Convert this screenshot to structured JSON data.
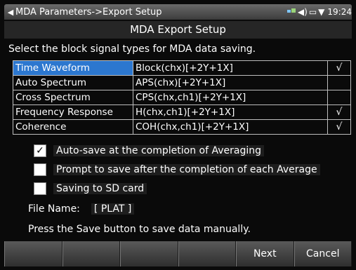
{
  "status_bar": {
    "title": "MDA Parameters->Export Setup",
    "time": "19:24"
  },
  "heading": "MDA Export Setup",
  "instruction": "Select the block signal types for MDA data saving.",
  "signal_table": [
    {
      "name": "Time Waveform",
      "formula": "Block(chx)[+2Y+1X]",
      "check": "√"
    },
    {
      "name": "Auto Spectrum",
      "formula": "APS(chx)[+2Y+1X]",
      "check": ""
    },
    {
      "name": "Cross Spectrum",
      "formula": "CPS(chx,ch1)[+2Y+1X]",
      "check": ""
    },
    {
      "name": "Frequency Response",
      "formula": "H(chx,ch1)[+2Y+1X]",
      "check": "√"
    },
    {
      "name": "Coherence",
      "formula": "COH(chx,ch1)[+2Y+1X]",
      "check": "√"
    }
  ],
  "options": {
    "autosave": {
      "label": "Auto-save at the completion of Averaging",
      "checked": true,
      "mark": "✓"
    },
    "prompt": {
      "label": "Prompt to save after the completion of each Average",
      "checked": false,
      "mark": ""
    },
    "sdcard": {
      "label": "Saving to SD card",
      "checked": false,
      "mark": ""
    }
  },
  "file_name": {
    "label": "File Name:",
    "value": "[ PLAT ]"
  },
  "hint": "Press the Save button to save data manually.",
  "softkeys": [
    "",
    "",
    "",
    "",
    "Next",
    "Cancel"
  ]
}
